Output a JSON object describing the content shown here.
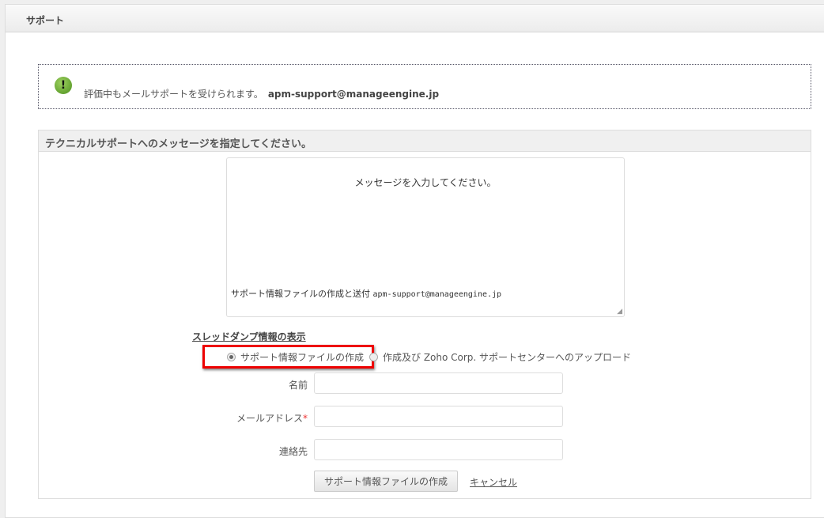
{
  "header": {
    "title": "サポート"
  },
  "notice": {
    "icon": "exclamation-icon",
    "text": "評価中もメールサポートを受けられます。",
    "email": "apm-support@manageengine.jp"
  },
  "section": {
    "title": "テクニカルサポートへのメッセージを指定してください。"
  },
  "message": {
    "placeholder": "メッセージを入力してください。",
    "line_text": "サポート情報ファイルの作成と送付",
    "line_email": "apm-support@manageengine.jp"
  },
  "thread_dump_link": "スレッドダンプ情報の表示",
  "options": [
    {
      "label": "サポート情報ファイルの作成",
      "selected": true
    },
    {
      "label": "作成及び Zoho Corp. サポートセンターへのアップロード",
      "selected": false
    }
  ],
  "form": {
    "name_label": "名前",
    "email_label": "メールアドレス",
    "required_mark": "*",
    "contact_label": "連絡先",
    "name_value": "",
    "email_value": "",
    "contact_value": ""
  },
  "buttons": {
    "create": "サポート情報ファイルの作成",
    "cancel": "キャンセル"
  }
}
